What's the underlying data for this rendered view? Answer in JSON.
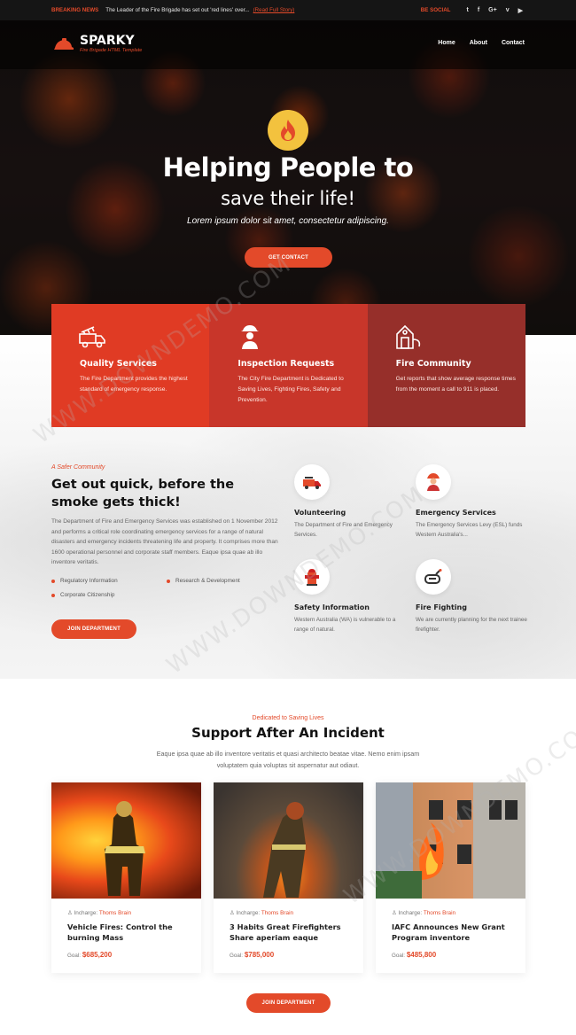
{
  "topbar": {
    "breaking_label": "BREAKING NEWS",
    "message": "The Leader of the Fire Brigade has set out 'red lines' over...",
    "read_link": "(Read Full Story)",
    "social_label": "BE SOCIAL",
    "social_icons": [
      "twitter-icon",
      "facebook-icon",
      "google-plus-icon",
      "vimeo-icon",
      "youtube-icon"
    ],
    "social_glyphs": [
      "t",
      "f",
      "G+",
      "v",
      "▶"
    ]
  },
  "header": {
    "brand": "SPARKY",
    "tagline": "Fire Brigade HTML Template",
    "nav": [
      "Home",
      "About",
      "Contact"
    ]
  },
  "hero": {
    "title": "Helping People to",
    "subtitle": "save their life!",
    "lead": "Lorem ipsum dolor sit amet, consectetur adipiscing.",
    "button": "GET CONTACT"
  },
  "features": [
    {
      "icon": "fire-truck-icon",
      "title": "Quality Services",
      "text": "The Fire Department provides the highest standard of emergency response.",
      "color": "#e03b24"
    },
    {
      "icon": "firefighter-icon",
      "title": "Inspection Requests",
      "text": "The City Fire Department is Dedicated to Saving Lives, Fighting Fires, Safety and Prevention.",
      "color": "#c8362a"
    },
    {
      "icon": "fire-station-icon",
      "title": "Fire Community",
      "text": "Get reports that show average response times from the moment a call to 911 is placed.",
      "color": "#962f2a"
    }
  ],
  "about": {
    "kicker": "A Safer Community",
    "title": "Get out quick, before the smoke gets thick!",
    "text": "The Department of Fire and Emergency Services was established on 1 November 2012 and performs a critical role coordinating emergency services for a range of natural disasters and emergency incidents threatening life and property. It comprises more than 1600 operational personnel and corporate staff members. Eaque ipsa quae ab illo inventore veritatis.",
    "bullets": [
      "Regulatory Information",
      "Research & Development",
      "Corporate Citizenship"
    ],
    "button": "JOIN DEPARTMENT"
  },
  "services": [
    {
      "icon": "fire-truck-icon",
      "title": "Volunteering",
      "text": "The Department of Fire and Emergency Services."
    },
    {
      "icon": "firefighter-icon",
      "title": "Emergency Services",
      "text": "The Emergency Services Levy (ESL) funds Western Australia's..."
    },
    {
      "icon": "fire-hydrant-icon",
      "title": "Safety Information",
      "text": "Western Australia (WA) is vulnerable to a range of natural."
    },
    {
      "icon": "fire-hose-icon",
      "title": "Fire Fighting",
      "text": "We are currently planning for the next trainee firefighter."
    }
  ],
  "support": {
    "kicker": "Dedicated to Saving Lives",
    "title": "Support After An Incident",
    "text": "Eaque ipsa quae ab illo inventore veritatis et quasi architecto beatae vitae. Nemo enim ipsam voluptatem quia voluptas sit aspernatur aut odiaut.",
    "incharge_label": "Incharge:",
    "goal_label": "Goal:",
    "cards": [
      {
        "incharge": "Thoms Brain",
        "title": "Vehicle Fires: Control the burning Mass",
        "goal": "$685,200"
      },
      {
        "incharge": "Thoms Brain",
        "title": "3 Habits Great Firefighters Share aperiam eaque",
        "goal": "$785,000"
      },
      {
        "incharge": "Thoms Brain",
        "title": "IAFC Announces New Grant Program inventore",
        "goal": "$485,800"
      }
    ],
    "button": "JOIN DEPARTMENT"
  },
  "watermark": "WWW.DOWNDEMO.COM"
}
